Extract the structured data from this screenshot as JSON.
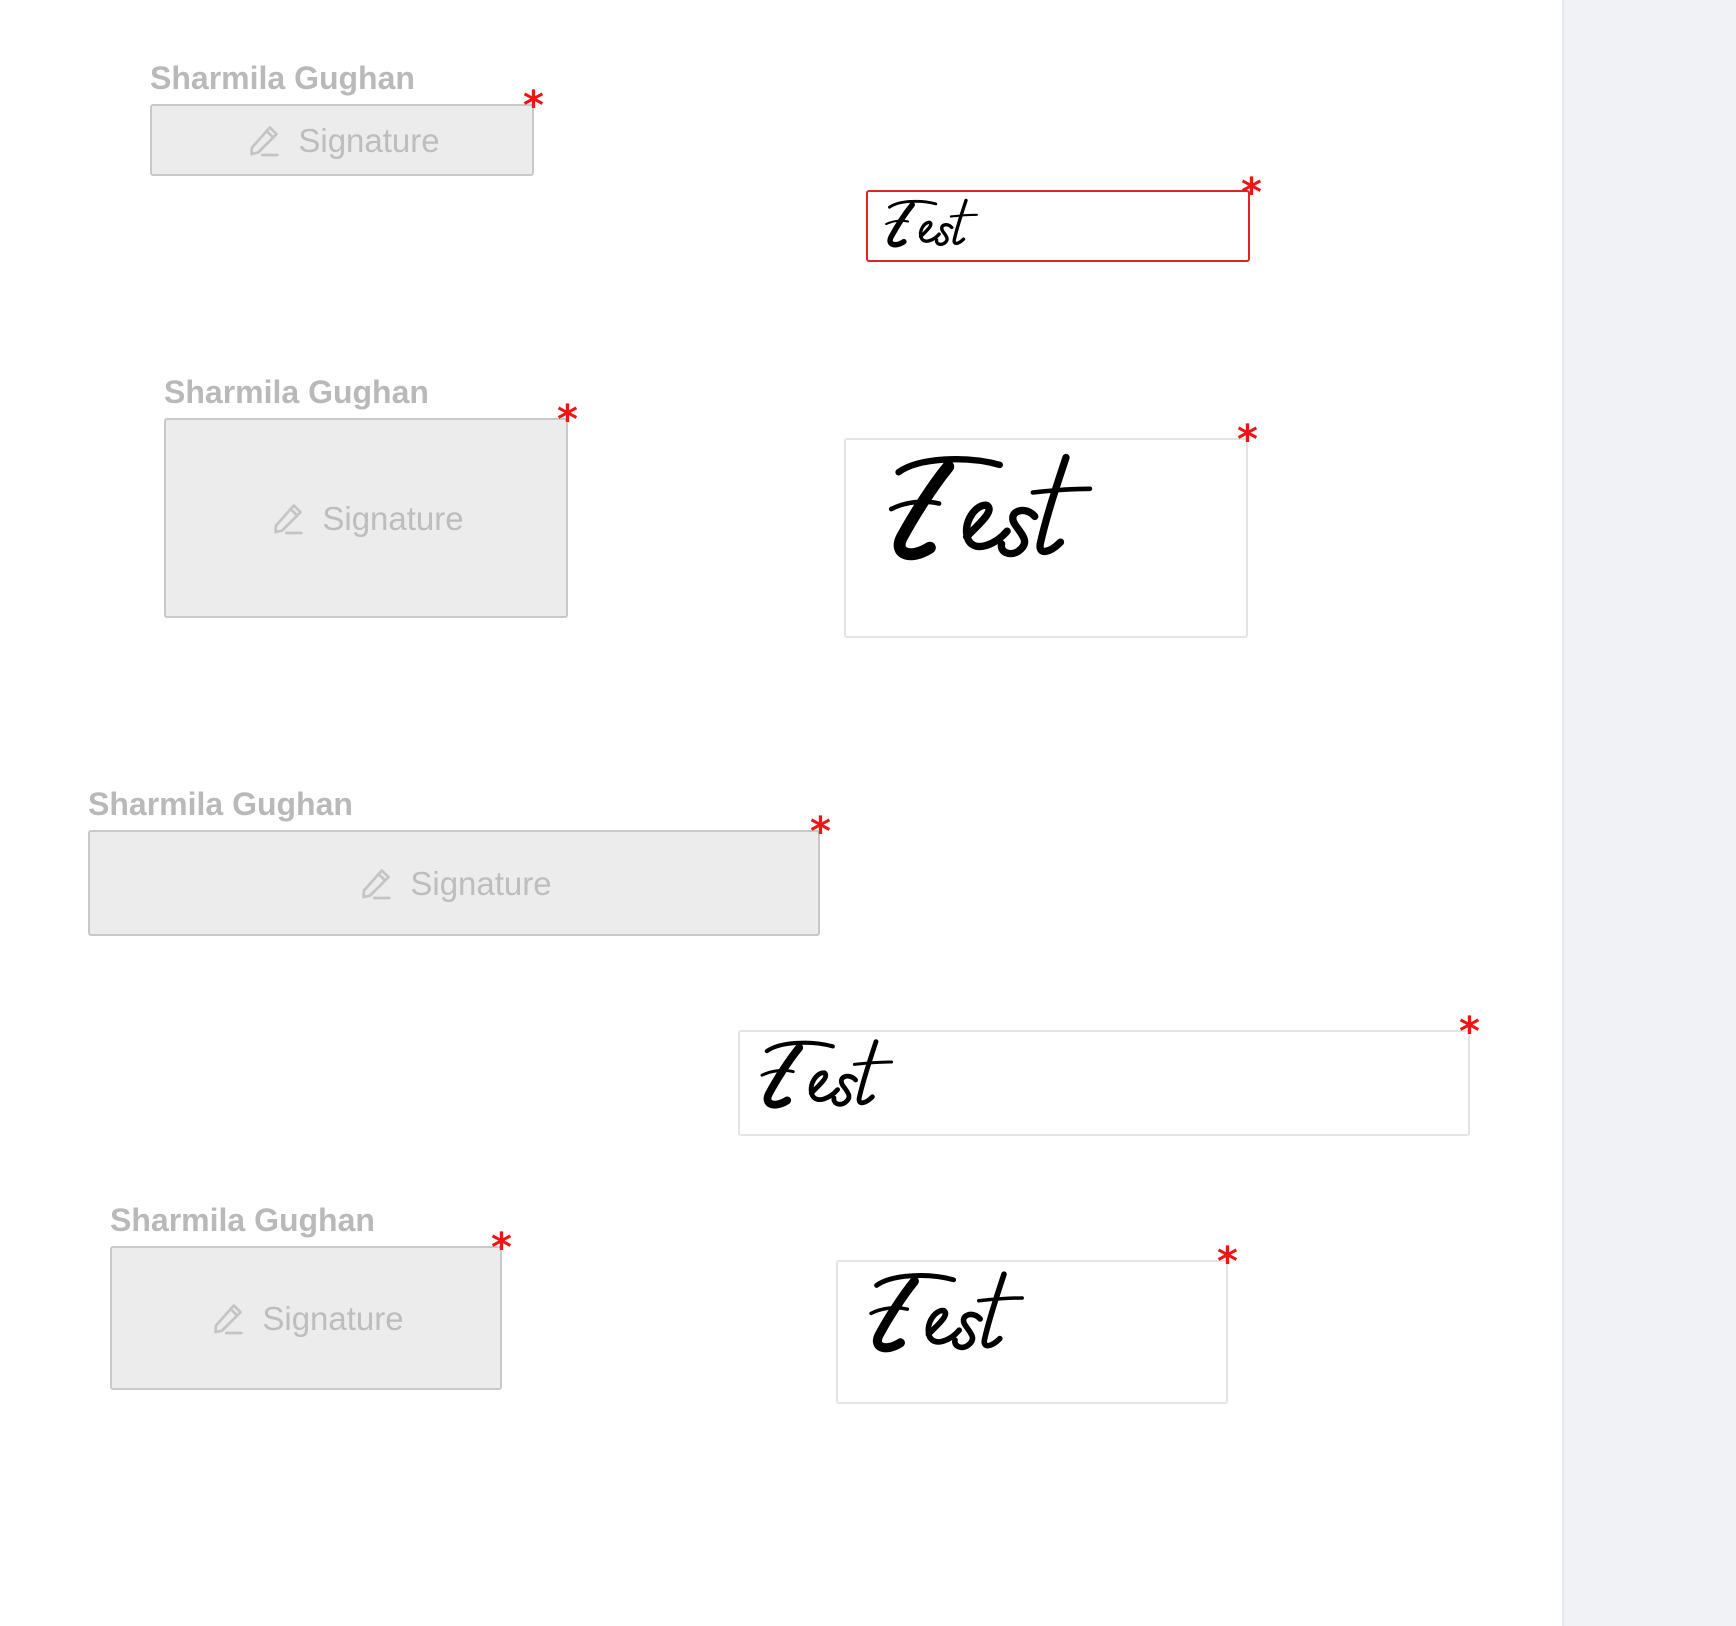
{
  "colors": {
    "label": "#b9b9b9",
    "field_bg": "#ececec",
    "field_border": "#c9c9c9",
    "placeholder_text": "#bdbdbd",
    "required_marker": "#f01515",
    "active_border": "#e02424",
    "gutter_bg": "#f1f2f6"
  },
  "required_marker": "*",
  "signature_fields": [
    {
      "signer_name": "Sharmila Gughan",
      "placeholder": "Signature",
      "icon": "pen-icon"
    },
    {
      "signer_name": "Sharmila Gughan",
      "placeholder": "Signature",
      "icon": "pen-icon"
    },
    {
      "signer_name": "Sharmila Gughan",
      "placeholder": "Signature",
      "icon": "pen-icon"
    },
    {
      "signer_name": "Sharmila Gughan",
      "placeholder": "Signature",
      "icon": "pen-icon"
    }
  ],
  "signed_fields": [
    {
      "signature_text": "Test",
      "state": "selected"
    },
    {
      "signature_text": "Test",
      "state": "filled"
    },
    {
      "signature_text": "Test",
      "state": "filled"
    },
    {
      "signature_text": "Test",
      "state": "filled"
    }
  ]
}
